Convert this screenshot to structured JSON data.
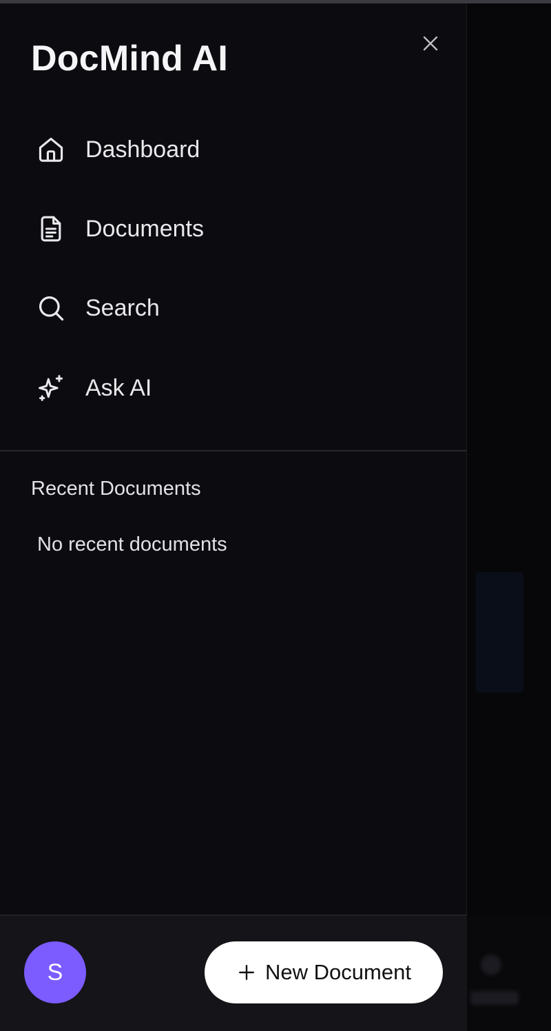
{
  "app": {
    "title": "DocMind AI"
  },
  "nav": {
    "items": [
      {
        "label": "Dashboard",
        "icon": "home-icon"
      },
      {
        "label": "Documents",
        "icon": "document-icon"
      },
      {
        "label": "Search",
        "icon": "search-icon"
      },
      {
        "label": "Ask AI",
        "icon": "sparkles-icon"
      }
    ]
  },
  "recent": {
    "heading": "Recent Documents",
    "empty_text": "No recent documents"
  },
  "footer": {
    "avatar_initial": "S",
    "new_document_label": "New Document"
  },
  "colors": {
    "accent": "#7c5cff",
    "drawer_bg": "#0c0c10",
    "footer_bg": "#141419",
    "text": "#e9e9ec"
  }
}
